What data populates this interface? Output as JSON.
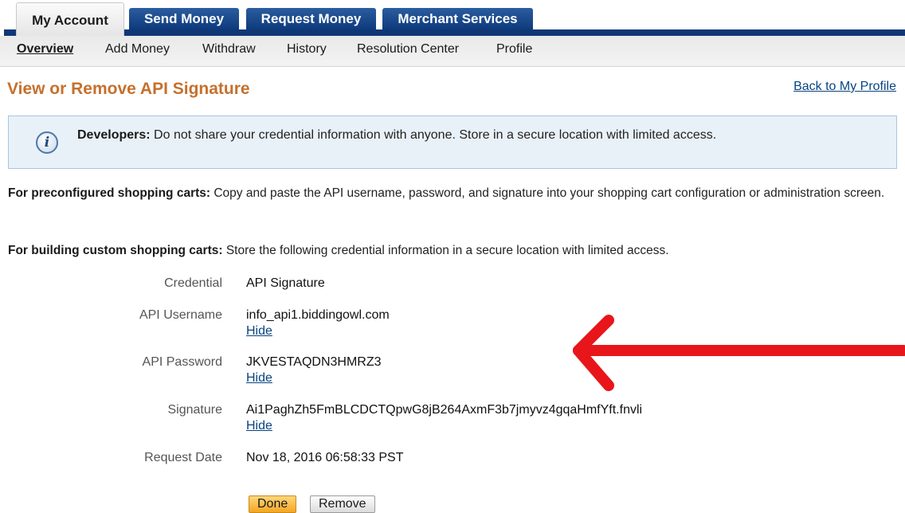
{
  "tabs": [
    {
      "label": "My Account",
      "active": true
    },
    {
      "label": "Send Money",
      "active": false
    },
    {
      "label": "Request Money",
      "active": false
    },
    {
      "label": "Merchant Services",
      "active": false
    }
  ],
  "subnav": [
    {
      "label": "Overview",
      "current": true
    },
    {
      "label": "Add Money",
      "current": false
    },
    {
      "label": "Withdraw",
      "current": false
    },
    {
      "label": "History",
      "current": false
    },
    {
      "label": "Resolution Center",
      "current": false
    },
    {
      "label": "Profile",
      "current": false
    }
  ],
  "page": {
    "title": "View or Remove API Signature",
    "back_link": "Back to My Profile"
  },
  "info": {
    "icon": "info-icon",
    "lead": "Developers:",
    "text": " Do not share your credential information with anyone. Store in a secure location with limited access."
  },
  "paragraphs": {
    "preconfigured_lead": "For preconfigured shopping carts:",
    "preconfigured_text": " Copy and paste the API username, password, and signature into your shopping cart configuration or administration screen.",
    "custom_lead": "For building custom shopping carts:",
    "custom_text": " Store the following credential information in a secure location with limited access."
  },
  "credentials": {
    "credential": {
      "label": "Credential",
      "value": "API Signature"
    },
    "username": {
      "label": "API Username",
      "value": "info_api1.biddingowl.com",
      "hide": "Hide"
    },
    "password": {
      "label": "API Password",
      "value": "JKVESTAQDN3HMRZ3",
      "hide": "Hide"
    },
    "signature": {
      "label": "Signature",
      "value": "Ai1PaghZh5FmBLCDCTQpwG8jB264AxmF3b7jmyvz4gqaHmfYft.fnvli",
      "hide": "Hide"
    },
    "request_date": {
      "label": "Request Date",
      "value": "Nov 18, 2016 06:58:33 PST"
    }
  },
  "buttons": {
    "done": "Done",
    "remove": "Remove"
  },
  "colors": {
    "tab_blue": "#0f3775",
    "title_orange": "#c5702d",
    "link_blue": "#084482",
    "arrow_red": "#e8151a"
  }
}
